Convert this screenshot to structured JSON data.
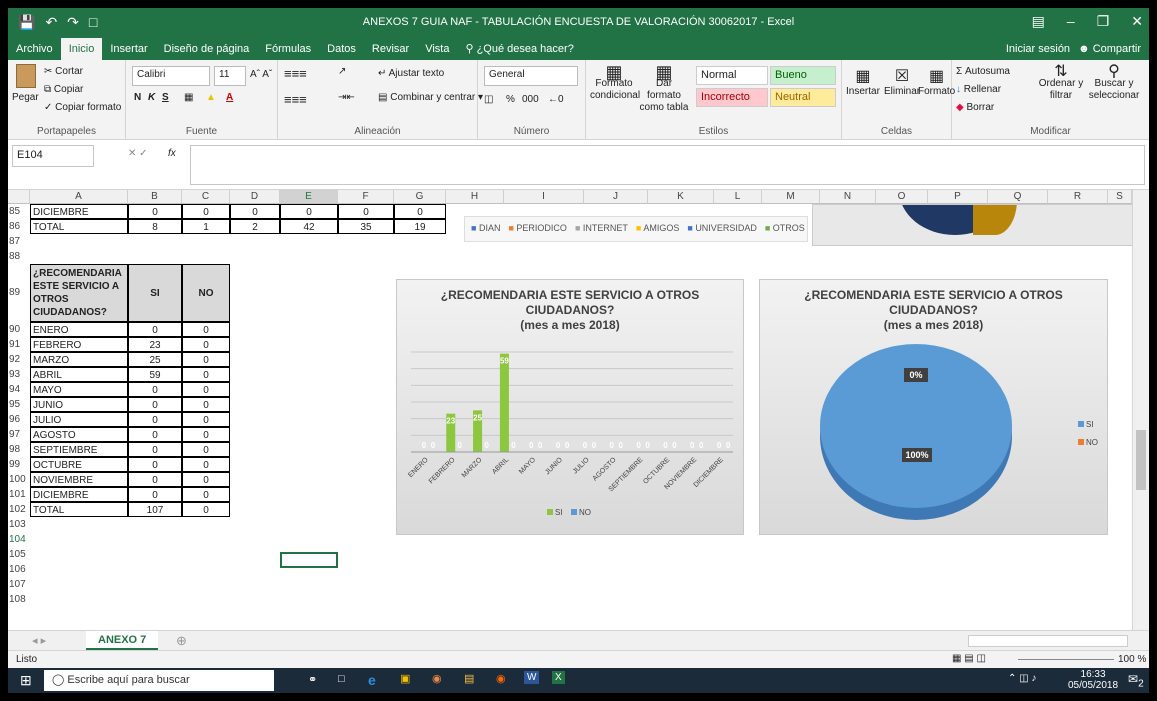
{
  "window": {
    "title": "ANEXOS 7 GUIA NAF - TABULACIÓN ENCUESTA DE VALORACIÓN 30062017  -  Excel",
    "signin": "Iniciar sesión",
    "share": "Compartir"
  },
  "tabs": [
    "Archivo",
    "Inicio",
    "Insertar",
    "Diseño de página",
    "Fórmulas",
    "Datos",
    "Revisar",
    "Vista"
  ],
  "tell_me": "¿Qué desea hacer?",
  "ribbon": {
    "clipboard": {
      "paste": "Pegar",
      "cut": "Cortar",
      "copy": "Copiar",
      "format_painter": "Copiar formato",
      "label": "Portapapeles"
    },
    "font": {
      "name": "Calibri",
      "size": "11",
      "label": "Fuente",
      "bold": "N",
      "italic": "K",
      "underline": "S"
    },
    "alignment": {
      "wrap": "Ajustar texto",
      "merge": "Combinar y centrar",
      "label": "Alineación"
    },
    "number": {
      "format": "General",
      "label": "Número",
      "percent": "%",
      "thousands": "000"
    },
    "styles": {
      "conditional": "Formato condicional",
      "as_table": "Dar formato como tabla",
      "normal": "Normal",
      "good": "Bueno",
      "bad": "Incorrecto",
      "neutral": "Neutral",
      "label": "Estilos"
    },
    "cells": {
      "insert": "Insertar",
      "delete": "Eliminar",
      "format": "Formato",
      "label": "Celdas"
    },
    "editing": {
      "autosum": "Autosuma",
      "fill": "Rellenar",
      "clear": "Borrar",
      "sort": "Ordenar y filtrar",
      "find": "Buscar y seleccionar",
      "label": "Modificar"
    }
  },
  "formula_bar": {
    "name_box": "E104",
    "fx": "fx",
    "value": ""
  },
  "columns": [
    "A",
    "B",
    "C",
    "D",
    "E",
    "F",
    "G",
    "H",
    "I",
    "J",
    "K",
    "L",
    "M",
    "N",
    "O",
    "P",
    "Q",
    "R",
    "S"
  ],
  "top_rows": [
    {
      "row": "85",
      "label": "DICIEMBRE",
      "vals": [
        "0",
        "0",
        "0",
        "0",
        "0",
        "0"
      ]
    },
    {
      "row": "86",
      "label": "TOTAL",
      "vals": [
        "8",
        "1",
        "2",
        "42",
        "35",
        "19"
      ]
    }
  ],
  "legend_top": [
    "DIAN",
    "PERIODICO",
    "INTERNET",
    "AMIGOS",
    "UNIVERSIDAD",
    "OTROS"
  ],
  "table": {
    "header_row": "89",
    "header": "¿RECOMENDARIA ESTE SERVICIO A OTROS CIUDADANOS?",
    "col_si": "SI",
    "col_no": "NO",
    "rows": [
      {
        "row": "90",
        "month": "ENERO",
        "si": "0",
        "no": "0"
      },
      {
        "row": "91",
        "month": "FEBRERO",
        "si": "23",
        "no": "0"
      },
      {
        "row": "92",
        "month": "MARZO",
        "si": "25",
        "no": "0"
      },
      {
        "row": "93",
        "month": "ABRIL",
        "si": "59",
        "no": "0"
      },
      {
        "row": "94",
        "month": "MAYO",
        "si": "0",
        "no": "0"
      },
      {
        "row": "95",
        "month": "JUNIO",
        "si": "0",
        "no": "0"
      },
      {
        "row": "96",
        "month": "JULIO",
        "si": "0",
        "no": "0"
      },
      {
        "row": "97",
        "month": "AGOSTO",
        "si": "0",
        "no": "0"
      },
      {
        "row": "98",
        "month": "SEPTIEMBRE",
        "si": "0",
        "no": "0"
      },
      {
        "row": "99",
        "month": "OCTUBRE",
        "si": "0",
        "no": "0"
      },
      {
        "row": "100",
        "month": "NOVIEMBRE",
        "si": "0",
        "no": "0"
      },
      {
        "row": "101",
        "month": "DICIEMBRE",
        "si": "0",
        "no": "0"
      }
    ],
    "total_row": {
      "row": "102",
      "label": "TOTAL",
      "si": "107",
      "no": "0"
    }
  },
  "extra_rows": [
    "87",
    "88",
    "103",
    "104",
    "105",
    "106",
    "107",
    "108"
  ],
  "sheet_tab": "ANEXO 7",
  "status": {
    "ready": "Listo",
    "zoom": "100 %"
  },
  "taskbar": {
    "search": "Escribe aquí para buscar",
    "time": "16:33",
    "date": "05/05/2018",
    "notif": "2"
  },
  "colors": {
    "excel_green": "#217346",
    "si": "#5b9bd5",
    "bar": "#8dc63f",
    "no": "#ed7d31"
  },
  "chart_data": [
    {
      "type": "bar",
      "title": "¿RECOMENDARIA ESTE SERVICIO A OTROS CIUDADANOS? (mes a mes 2018)",
      "title_lines": [
        "¿RECOMENDARIA ESTE SERVICIO A OTROS",
        "CIUDADANOS?",
        "(mes a mes 2018)"
      ],
      "categories": [
        "ENERO",
        "FEBRERO",
        "MARZO",
        "ABRIL",
        "MAYO",
        "JUNIO",
        "JULIO",
        "AGOSTO",
        "SEPTIEMBRE",
        "OCTUBRE",
        "NOVIEMBRE",
        "DICIEMBRE"
      ],
      "series": [
        {
          "name": "SI",
          "values": [
            0,
            23,
            25,
            59,
            0,
            0,
            0,
            0,
            0,
            0,
            0,
            0
          ]
        },
        {
          "name": "NO",
          "values": [
            0,
            0,
            0,
            0,
            0,
            0,
            0,
            0,
            0,
            0,
            0,
            0
          ]
        }
      ],
      "legend": "bottom"
    },
    {
      "type": "pie",
      "title": "¿RECOMENDARIA ESTE SERVICIO A OTROS CIUDADANOS? (mes a mes 2018)",
      "title_lines": [
        "¿RECOMENDARIA ESTE SERVICIO A OTROS",
        "CIUDADANOS?",
        "(mes a mes 2018)"
      ],
      "labels": [
        "SI",
        "NO"
      ],
      "values": [
        100,
        0
      ],
      "data_labels": [
        "100%",
        "0%"
      ],
      "legend": "right"
    }
  ]
}
